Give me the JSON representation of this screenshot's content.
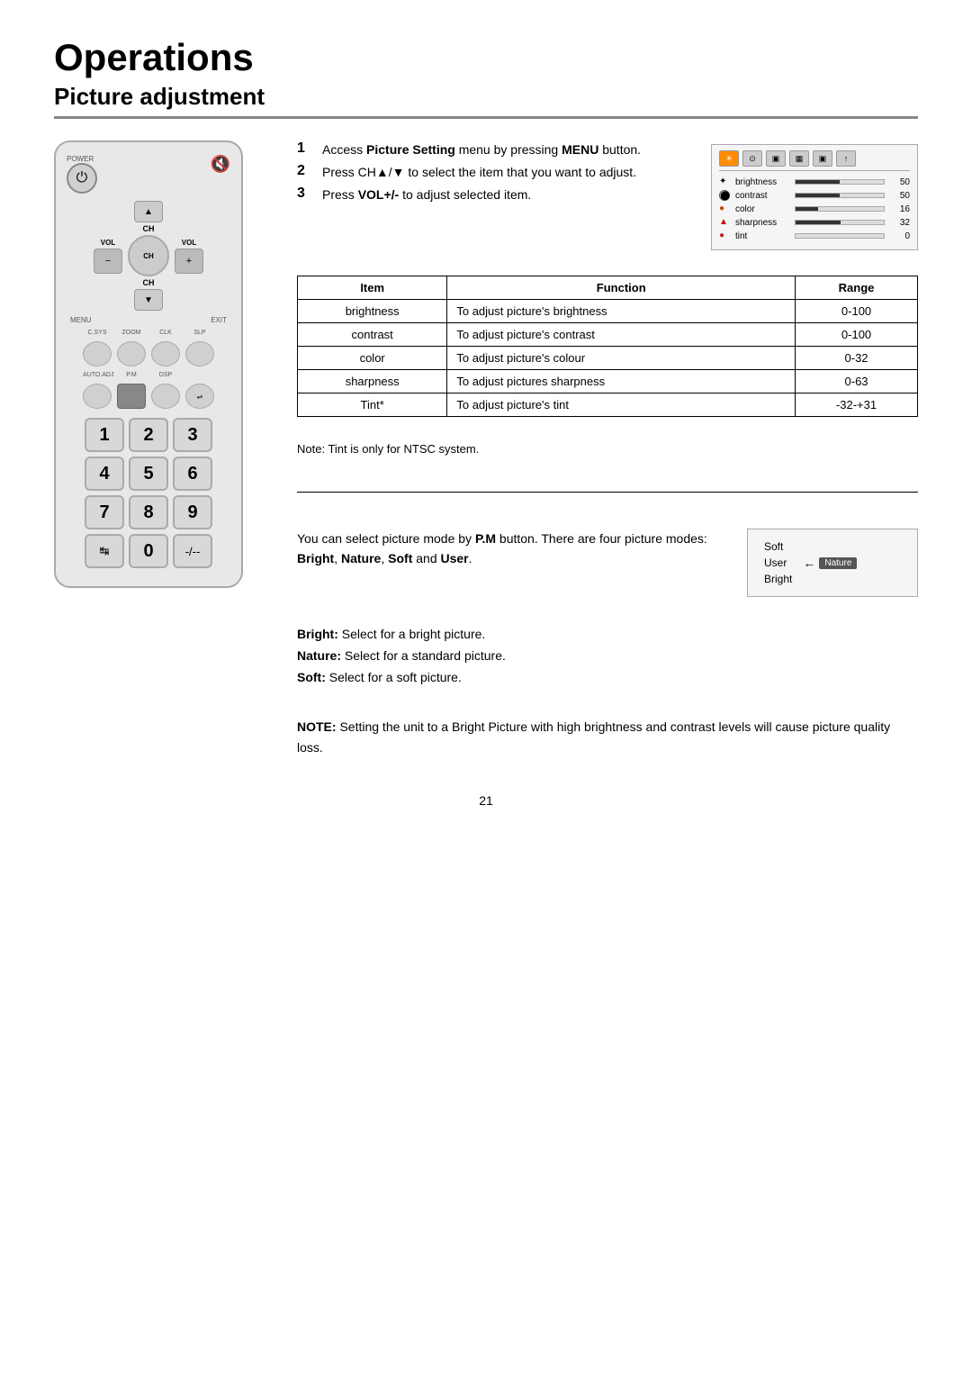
{
  "page": {
    "main_title": "Operations",
    "section_title": "Picture adjustment",
    "page_number": "21"
  },
  "steps": [
    {
      "num": "1",
      "text_plain": "Access ",
      "text_bold": "Picture Setting",
      "text_after": " menu by pressing ",
      "text_bold2": "MENU",
      "text_end": " button."
    },
    {
      "num": "2",
      "text_plain": "Press CH▲/▼ to select the item that you want to adjust."
    },
    {
      "num": "3",
      "text_plain": "Press ",
      "text_bold": "VOL+/-",
      "text_after": " to adjust selected item."
    }
  ],
  "picture_menu": {
    "tabs": [
      "☀",
      "⊙",
      "▣",
      "▦",
      "▣",
      "↑"
    ],
    "rows": [
      {
        "icon_color": "#ffaa00",
        "label": "brightness",
        "fill_pct": 50,
        "value": "50"
      },
      {
        "icon_color": "#ffffff",
        "label": "contrast",
        "fill_pct": 50,
        "value": "50"
      },
      {
        "icon_color": "#cc4400",
        "label": "color",
        "fill_pct": 25,
        "value": "16"
      },
      {
        "icon_color": "#cc0000",
        "label": "sharpness",
        "fill_pct": 50,
        "value": "32"
      },
      {
        "icon_color": "#cc2222",
        "label": "tint",
        "fill_pct": 0,
        "value": "0"
      }
    ]
  },
  "table": {
    "headers": [
      "Item",
      "Function",
      "Range"
    ],
    "rows": [
      {
        "item": "brightness",
        "function": "To adjust picture's brightness",
        "range": "0-100"
      },
      {
        "item": "contrast",
        "function": "To adjust picture's contrast",
        "range": "0-100"
      },
      {
        "item": "color",
        "function": "To adjust picture's colour",
        "range": "0-32"
      },
      {
        "item": "sharpness",
        "function": "To adjust pictures sharpness",
        "range": "0-63"
      },
      {
        "item": "Tint*",
        "function": "To adjust picture's tint",
        "range": "-32-+31"
      }
    ]
  },
  "note_tint": "Note: Tint is only for NTSC system.",
  "pm_section": {
    "intro": "You can select picture mode by ",
    "intro_bold": "P.M",
    "intro_after": " button. There are four picture modes: ",
    "modes_bold": "Bright, Nature,",
    "modes_after": "",
    "soft_user": "Soft",
    "and_user": " and ",
    "user_bold": "User",
    "period": ".",
    "selector_items": [
      "Soft",
      "User",
      "Bright"
    ],
    "selected_item": "Nature",
    "arrow_label": "Nature"
  },
  "pm_descriptions": [
    {
      "label": "Bright:",
      "text": " Select for a bright picture."
    },
    {
      "label": "Nature:",
      "text": " Select for a standard picture."
    },
    {
      "label": "Soft:",
      "text": " Select for a soft picture."
    }
  ],
  "note_block": {
    "label": "NOTE:",
    "text": " Setting the unit to a Bright Picture with high brightness and contrast levels will cause picture quality loss."
  },
  "remote": {
    "power_label": "POWER",
    "ch_up": "▲",
    "ch_label": "CH",
    "vol_minus": "−",
    "vol_plus": "+",
    "ch_down": "▼",
    "vol_label": "VOL",
    "menu_label": "MENU",
    "exit_label": "EXIT",
    "btn_labels_row1": [
      "C.SYS",
      "ZOOM",
      "CLK",
      "SLP"
    ],
    "btn_labels_row2": [
      "AUTO.ADJ",
      "P.M",
      "DSP",
      ""
    ],
    "numpad": [
      "1",
      "2",
      "3",
      "4",
      "5",
      "6",
      "7",
      "8",
      "9"
    ],
    "special": [
      "↹",
      "0",
      "-/--"
    ]
  }
}
